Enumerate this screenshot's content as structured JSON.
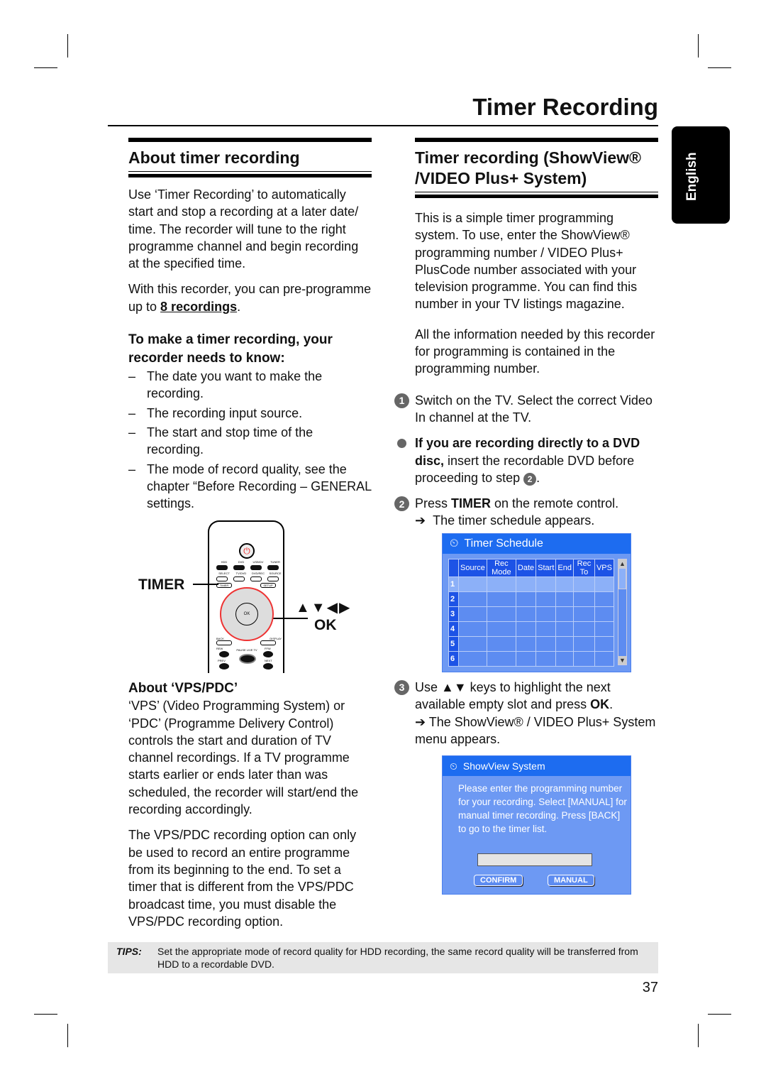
{
  "header": {
    "title": "Timer Recording",
    "language_tab": "English"
  },
  "left": {
    "heading": "About timer recording",
    "intro": "Use ‘Timer Recording’ to automatically start and stop a recording at a later date/ time. The recorder will tune to the right programme channel and begin recording at the specified time.",
    "capacity_prefix": "With this recorder, you can pre-programme up to ",
    "capacity_link": "8 recordings",
    "capacity_suffix": ".",
    "know_heading": "To make a timer recording, your recorder needs to know:",
    "know_items": [
      "The date you want to make the recording.",
      "The recording input source.",
      "The start and stop time of the recording.",
      "The mode of record quality, see the chapter “Before Recording – GENERAL settings."
    ],
    "remote": {
      "timer_callout": "TIMER",
      "nav_callout": "▲▼◀▶",
      "ok_callout": "OK",
      "keys": [
        "HDD",
        "DVD",
        "USB/DV",
        "TUNER",
        "SELECT",
        "TV/DVD",
        "DVD/REC",
        "SOURCE",
        "TIMER",
        "SETUP",
        "OK",
        "BACK",
        "DISPLAY",
        "REW",
        "FFW",
        "PAUSE LIVE TV",
        "PREV",
        "NEXT"
      ]
    },
    "vps_heading": "About ‘VPS/PDC’",
    "vps_p1": "‘VPS’ (Video Programming System) or ‘PDC’ (Programme Delivery Control) controls the start and duration of TV channel recordings. If a TV programme starts earlier or ends later than was scheduled, the recorder will start/end the recording accordingly.",
    "vps_p2": "The VPS/PDC recording option can only be used to record an entire programme from its beginning to the end. To set a timer that is different from the VPS/PDC broadcast time, you must disable the VPS/PDC recording option."
  },
  "right": {
    "heading_line1": "Timer recording (ShowView®",
    "heading_line2": "/VIDEO Plus+ System)",
    "p1": "This is a simple timer programming system. To use, enter the ShowView® programming number / VIDEO Plus+ PlusCode number associated with your television programme. You can find this number in your TV listings magazine.",
    "p2": "All the information needed by this recorder for programming is contained in the programming number.",
    "step1_num": "1",
    "step1": "Switch on the TV. Select the correct Video In channel at the TV.",
    "bullet_bold": "If you are recording directly to a DVD disc,",
    "bullet_rest": " insert the recordable DVD before proceeding to step ",
    "bullet_step": "2",
    "bullet_end": ".",
    "step2_num": "2",
    "step2_pre": "Press ",
    "step2_bold": "TIMER",
    "step2_post": " on the remote control.",
    "step2_result": "The timer schedule appears.",
    "timer_schedule": {
      "title": "Timer Schedule",
      "columns": [
        "Source",
        "Rec Mode",
        "Date",
        "Start",
        "End",
        "Rec To",
        "VPS"
      ],
      "rows": [
        "1",
        "2",
        "3",
        "4",
        "5",
        "6"
      ],
      "selected_row": "1"
    },
    "step3_num": "3",
    "step3_pre": "Use ",
    "step3_keys": "▲▼",
    "step3_mid": " keys to highlight the next available empty slot and press ",
    "step3_bold": "OK",
    "step3_end": ".",
    "step3_result": "The ShowView® / VIDEO Plus+ System menu appears.",
    "showview": {
      "title": "ShowView System",
      "message": "Please enter the programming number for your recording. Select [MANUAL] for manual timer recording. Press [BACK] to go to the timer list.",
      "input_value": "",
      "confirm": "CONFIRM",
      "manual": "MANUAL"
    }
  },
  "tips": {
    "label": "TIPS:",
    "text": "Set the appropriate mode of record quality for HDD recording, the same record quality will be transferred from HDD to a recordable DVD."
  },
  "page_number": "37",
  "colors": {
    "osd_bar": "#1d6cf0",
    "osd_body": "#6d99f3",
    "tips_bg": "#e6e6e6",
    "tab": "#000000"
  }
}
